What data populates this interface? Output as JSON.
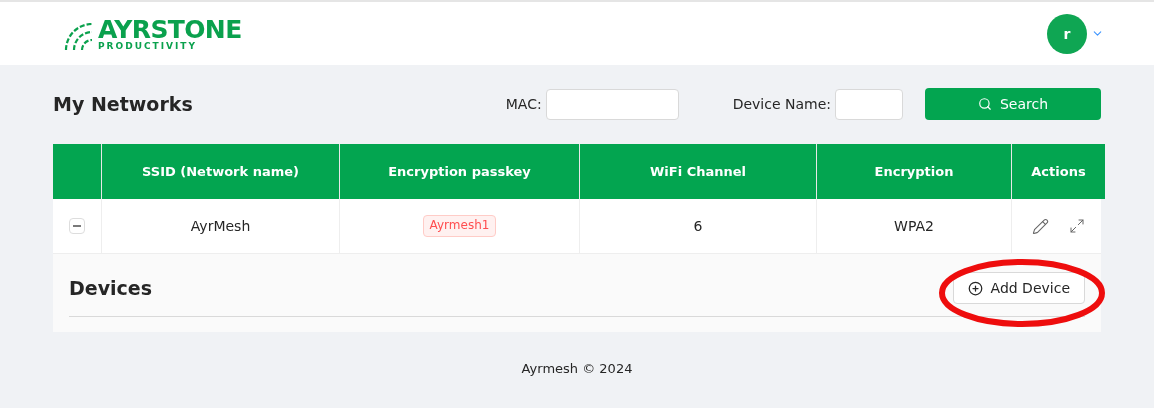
{
  "logo": {
    "name": "AYRSTONE",
    "tagline": "PRODUCTIVITY"
  },
  "user": {
    "initial": "r"
  },
  "page_title": "My Networks",
  "filters": [
    {
      "label": "MAC:"
    },
    {
      "label": "Device Name:"
    }
  ],
  "search_button": "Search",
  "table": {
    "columns": [
      "SSID (Network name)",
      "Encryption passkey",
      "WiFi Channel",
      "Encryption",
      "Actions"
    ],
    "rows": [
      {
        "expanded": true,
        "ssid": "AyrMesh",
        "passkey": "Ayrmesh1",
        "channel": "6",
        "encryption": "WPA2"
      }
    ]
  },
  "devices": {
    "title": "Devices",
    "add_button": "Add Device"
  },
  "footer": "Ayrmesh © 2024"
}
